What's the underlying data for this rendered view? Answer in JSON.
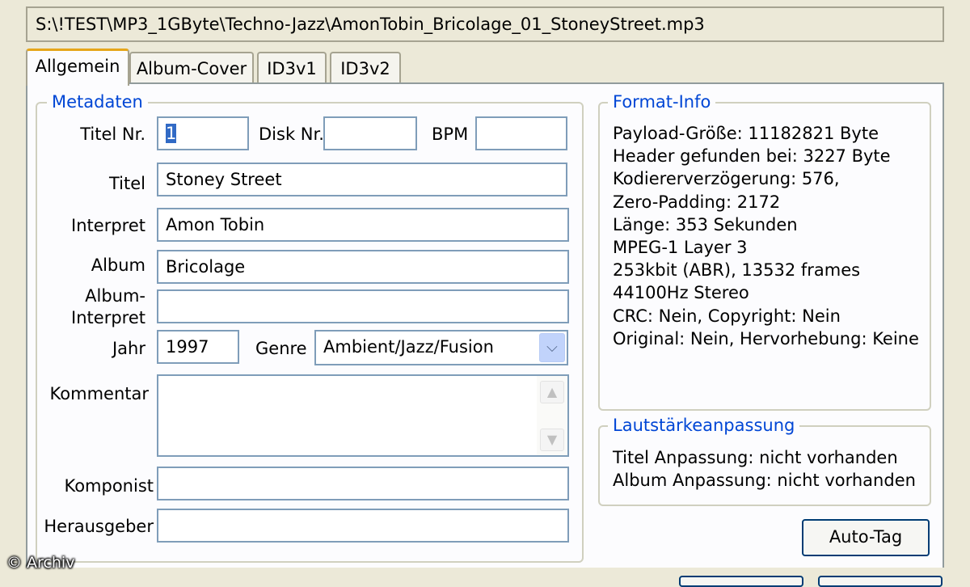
{
  "file_path": "S:\\!TEST\\MP3_1GByte\\Techno-Jazz\\AmonTobin_Bricolage_01_StoneyStreet.mp3",
  "tabs": [
    {
      "label": "Allgemein",
      "active": true
    },
    {
      "label": "Album-Cover",
      "active": false
    },
    {
      "label": "ID3v1",
      "active": false
    },
    {
      "label": "ID3v2",
      "active": false
    }
  ],
  "metadata": {
    "legend": "Metadaten",
    "track_no": {
      "label": "Titel Nr.",
      "value": "1"
    },
    "disc_no": {
      "label": "Disk Nr.",
      "value": ""
    },
    "bpm": {
      "label": "BPM",
      "value": ""
    },
    "title": {
      "label": "Titel",
      "value": "Stoney Street"
    },
    "artist": {
      "label": "Interpret",
      "value": "Amon Tobin"
    },
    "album": {
      "label": "Album",
      "value": "Bricolage"
    },
    "album_artist": {
      "label_line1": "Album-",
      "label_line2": "Interpret",
      "value": ""
    },
    "year": {
      "label": "Jahr",
      "value": "1997"
    },
    "genre": {
      "label": "Genre",
      "value": "Ambient/Jazz/Fusion"
    },
    "comment": {
      "label": "Kommentar",
      "value": ""
    },
    "composer": {
      "label": "Komponist",
      "value": ""
    },
    "publisher": {
      "label": "Herausgeber",
      "value": ""
    }
  },
  "format_info": {
    "legend": "Format-Info",
    "lines": [
      "Payload-Größe: 11182821 Byte",
      "Header gefunden bei: 3227 Byte",
      "Kodiererverzögerung: 576,",
      "Zero-Padding: 2172",
      "Länge: 353 Sekunden",
      "MPEG-1 Layer 3",
      "253kbit (ABR), 13532 frames",
      "44100Hz Stereo",
      "CRC: Nein, Copyright: Nein",
      "Original: Nein, Hervorhebung: Keine"
    ]
  },
  "volume": {
    "legend": "Lautstärkeanpassung",
    "lines": [
      "Titel Anpassung: nicht vorhanden",
      "Album Anpassung: nicht vorhanden"
    ]
  },
  "auto_tag_label": "Auto-Tag",
  "watermark": "© Archiv",
  "icons": {
    "genre_dropdown": "chevron-down-icon",
    "scroll_up": "scroll-up-arrow-icon",
    "scroll_down": "scroll-down-arrow-icon"
  },
  "colors": {
    "window_bg": "#ece9d8",
    "group_title": "#0046d5",
    "field_border": "#7f9db9",
    "active_tab_accent": "#e6a61a"
  }
}
